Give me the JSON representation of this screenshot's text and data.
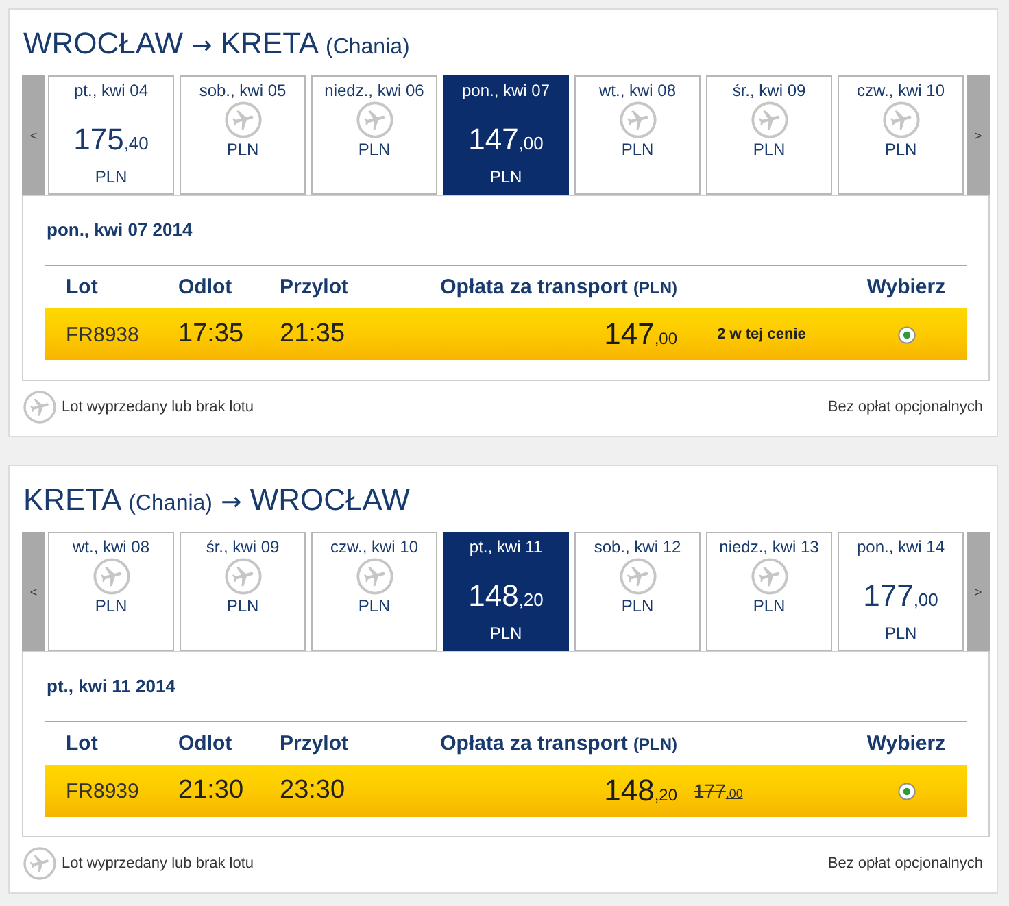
{
  "sections": [
    {
      "title": [
        {
          "kind": "city",
          "text": "WROCŁAW"
        },
        {
          "kind": "arrow",
          "text": "→"
        },
        {
          "kind": "city",
          "text": "KRETA"
        },
        {
          "kind": "note",
          "text": "(Chania)"
        }
      ],
      "prev_label": "<",
      "next_label": ">",
      "days": [
        {
          "kind": "fare",
          "date": "pt., kwi 04",
          "price": "175",
          "decimals": ",40",
          "currency": "PLN",
          "selected": false
        },
        {
          "kind": "no_flight",
          "date": "sob., kwi 05",
          "currency": "PLN",
          "selected": false
        },
        {
          "kind": "no_flight",
          "date": "niedz., kwi 06",
          "currency": "PLN",
          "selected": false
        },
        {
          "kind": "fare",
          "date": "pon., kwi 07",
          "price": "147",
          "decimals": ",00",
          "currency": "PLN",
          "selected": true
        },
        {
          "kind": "no_flight",
          "date": "wt., kwi 08",
          "currency": "PLN",
          "selected": false
        },
        {
          "kind": "no_flight",
          "date": "śr., kwi 09",
          "currency": "PLN",
          "selected": false
        },
        {
          "kind": "no_flight",
          "date": "czw., kwi 10",
          "currency": "PLN",
          "selected": false
        }
      ],
      "date_heading": "pon., kwi 07 2014",
      "columns": [
        {
          "label": "Lot"
        },
        {
          "label": "Odlot"
        },
        {
          "label": "Przylot"
        },
        {
          "label": "Opłata za transport",
          "unit": "(PLN)"
        },
        {
          "label": "Wybierz"
        }
      ],
      "flights": [
        {
          "flight": "FR8938",
          "departure": "17:35",
          "arrival": "21:35",
          "price": "147",
          "decimals": ",00",
          "note": "2 w tej cenie",
          "selected": true
        }
      ],
      "legend": "Lot wyprzedany lub brak lotu",
      "fees_note": "Bez opłat opcjonalnych"
    },
    {
      "title": [
        {
          "kind": "city",
          "text": "KRETA"
        },
        {
          "kind": "note",
          "text": "(Chania)"
        },
        {
          "kind": "arrow",
          "text": "→"
        },
        {
          "kind": "city",
          "text": "WROCŁAW"
        }
      ],
      "prev_label": "<",
      "next_label": ">",
      "days": [
        {
          "kind": "no_flight",
          "date": "wt., kwi 08",
          "currency": "PLN",
          "selected": false
        },
        {
          "kind": "no_flight",
          "date": "śr., kwi 09",
          "currency": "PLN",
          "selected": false
        },
        {
          "kind": "no_flight",
          "date": "czw., kwi 10",
          "currency": "PLN",
          "selected": false
        },
        {
          "kind": "fare",
          "date": "pt., kwi 11",
          "price": "148",
          "decimals": ",20",
          "currency": "PLN",
          "selected": true
        },
        {
          "kind": "no_flight",
          "date": "sob., kwi 12",
          "currency": "PLN",
          "selected": false
        },
        {
          "kind": "no_flight",
          "date": "niedz., kwi 13",
          "currency": "PLN",
          "selected": false
        },
        {
          "kind": "fare",
          "date": "pon., kwi 14",
          "price": "177",
          "decimals": ",00",
          "currency": "PLN",
          "selected": false
        }
      ],
      "date_heading": "pt., kwi 11 2014",
      "columns": [
        {
          "label": "Lot"
        },
        {
          "label": "Odlot"
        },
        {
          "label": "Przylot"
        },
        {
          "label": "Opłata za transport",
          "unit": "(PLN)"
        },
        {
          "label": "Wybierz"
        }
      ],
      "flights": [
        {
          "flight": "FR8939",
          "departure": "21:30",
          "arrival": "23:30",
          "price": "148",
          "decimals": ",20",
          "old_price": "177",
          "old_decimals": ",00",
          "selected": true
        }
      ],
      "legend": "Lot wyprzedany lub brak lotu",
      "fees_note": "Bez opłat opcjonalnych"
    }
  ]
}
